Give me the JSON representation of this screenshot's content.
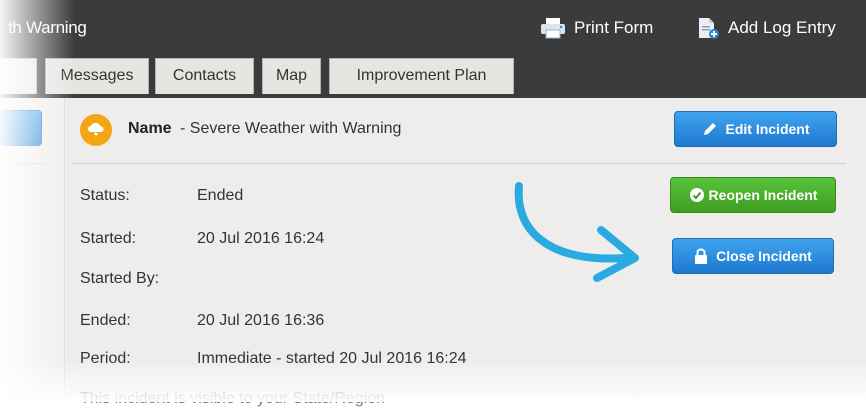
{
  "window": {
    "title": "th Warning"
  },
  "toolbar": {
    "print_label": "Print Form",
    "add_log_label": "Add Log Entry"
  },
  "tabs": [
    {
      "label": "Messages"
    },
    {
      "label": "Contacts"
    },
    {
      "label": "Map"
    },
    {
      "label": "Improvement Plan"
    }
  ],
  "incident": {
    "name_label": "Name",
    "name_value": "- Severe Weather with Warning",
    "fields": [
      {
        "label": "Status:",
        "value": "Ended"
      },
      {
        "label": "Started:",
        "value": "20 Jul 2016 16:24"
      },
      {
        "label": "Started By:",
        "value": ""
      },
      {
        "label": "Ended:",
        "value": "20 Jul 2016 16:36"
      },
      {
        "label": "Period:",
        "value": "Immediate - started 20 Jul 2016 16:24"
      }
    ],
    "visibility_note": "This incident is visible to your State/Region"
  },
  "actions": {
    "edit_label": "Edit Incident",
    "reopen_label": "Reopen Incident",
    "close_label": "Close Incident"
  },
  "colors": {
    "header_bg": "#3b3b3b",
    "primary_blue": "#1e79cf",
    "success_green": "#3e9d22",
    "weather_orange": "#f2a516",
    "annotation_arrow": "#29abe2"
  },
  "icons": {
    "print": "printer-icon",
    "add_log": "document-add-icon",
    "weather": "storm-cloud-icon",
    "edit": "pencil-icon",
    "reopen": "check-circle-icon",
    "close": "lock-icon"
  }
}
